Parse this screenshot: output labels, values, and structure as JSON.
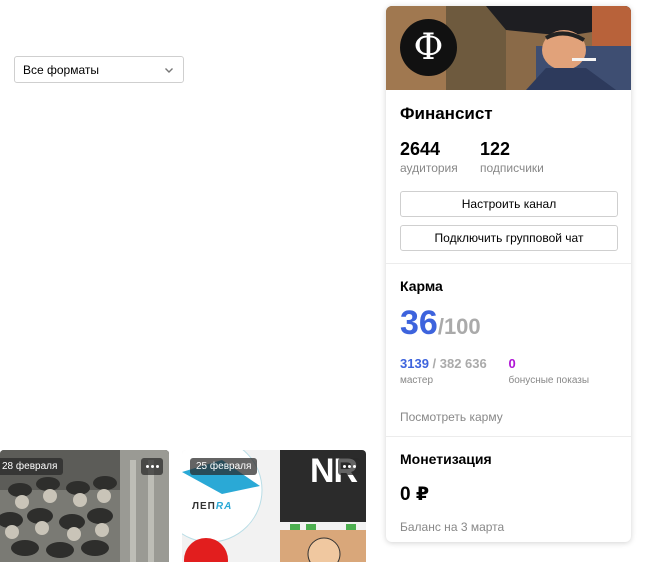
{
  "filter": {
    "format_label": "Все форматы"
  },
  "feed": [
    {
      "date": "28 февраля"
    },
    {
      "date": "25 февраля",
      "brand_text_1": "ЛЕП",
      "brand_text_2": "RA",
      "logo_text": "NR"
    }
  ],
  "channel": {
    "avatar_letter": "Ф",
    "name": "Финансист",
    "stats": [
      {
        "value": "2644",
        "label": "аудитория"
      },
      {
        "value": "122",
        "label": "подписчики"
      }
    ],
    "buttons": {
      "configure": "Настроить канал",
      "group_chat": "Подключить групповой чат"
    }
  },
  "karma": {
    "title": "Карма",
    "score": "36",
    "max": "/100",
    "rank_value": "3139",
    "rank_total": " / 382 636",
    "rank_label": "мастер",
    "bonus_value": "0",
    "bonus_label": "бонусные показы",
    "link": "Посмотреть карму"
  },
  "monetization": {
    "title": "Монетизация",
    "amount": "0 ₽",
    "balance_note": "Баланс на 3 марта"
  },
  "colors": {
    "accent": "#3d63dd",
    "bonus": "#b014d6"
  }
}
